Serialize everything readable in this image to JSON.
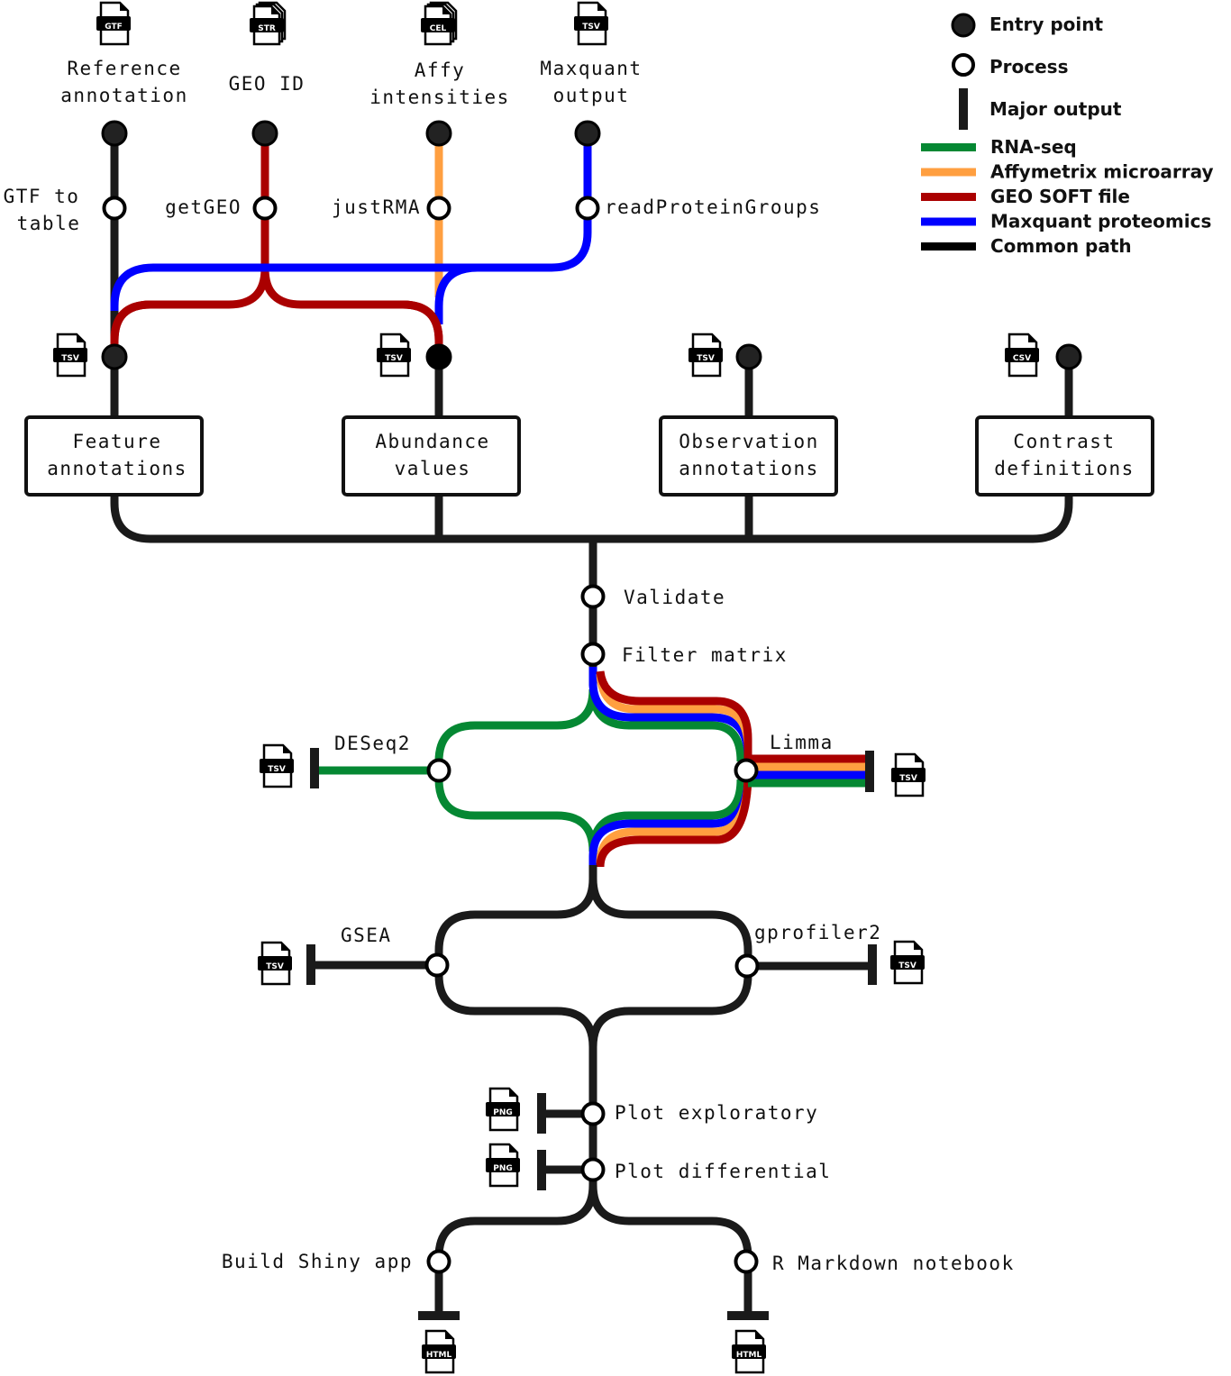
{
  "colors": {
    "rnaseq": "#058833",
    "affy": "#ff9f40",
    "geo": "#aa0000",
    "maxquant": "#0000ff",
    "common": "#1a1a1a"
  },
  "legend": {
    "entry_point": "Entry point",
    "process": "Process",
    "major_output": "Major output",
    "lines": [
      {
        "label": "RNA-seq",
        "color": "#058833"
      },
      {
        "label": "Affymetrix microarray",
        "color": "#ff9f40"
      },
      {
        "label": "GEO SOFT file",
        "color": "#aa0000"
      },
      {
        "label": "Maxquant proteomics",
        "color": "#0000ff"
      },
      {
        "label": "Common path",
        "color": "#000000"
      }
    ]
  },
  "inputs": {
    "reference": {
      "file": "GTF",
      "line1": "Reference",
      "line2": "annotation"
    },
    "geo_id": {
      "file": "STR",
      "line1": "GEO ID"
    },
    "affy": {
      "file": "CEL",
      "line1": "Affy",
      "line2": "intensities"
    },
    "maxquant": {
      "file": "TSV",
      "line1": "Maxquant",
      "line2": "output"
    }
  },
  "preprocess": {
    "gtf_to_table": {
      "line1": "GTF to",
      "line2": "table"
    },
    "getgeo": "getGEO",
    "justrma": "justRMA",
    "readproteingroups": "readProteinGroups"
  },
  "boxes": {
    "feature": {
      "file": "TSV",
      "line1": "Feature",
      "line2": "annotations"
    },
    "abundance": {
      "file": "TSV",
      "line1": "Abundance",
      "line2": "values"
    },
    "observation": {
      "file": "TSV",
      "line1": "Observation",
      "line2": "annotations"
    },
    "contrast": {
      "file": "CSV",
      "line1": "Contrast",
      "line2": "definitions"
    }
  },
  "steps": {
    "validate": "Validate",
    "filter": "Filter matrix",
    "deseq2": {
      "label": "DESeq2",
      "file": "TSV"
    },
    "limma": {
      "label": "Limma",
      "file": "TSV"
    },
    "gsea": {
      "label": "GSEA",
      "file": "TSV"
    },
    "gprofiler": {
      "label": "gprofiler2",
      "file": "TSV"
    },
    "plot_exploratory": {
      "label": "Plot exploratory",
      "file": "PNG"
    },
    "plot_differential": {
      "label": "Plot differential",
      "file": "PNG"
    },
    "shiny": {
      "label": "Build Shiny app",
      "file": "HTML"
    },
    "rmarkdown": {
      "label": "R Markdown notebook",
      "file": "HTML"
    }
  }
}
